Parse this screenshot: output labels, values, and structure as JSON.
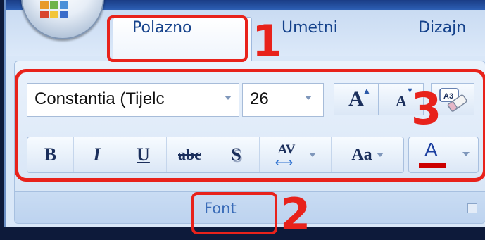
{
  "tabs": [
    {
      "label": "Polazno",
      "active": true
    },
    {
      "label": "Umetni",
      "active": false
    },
    {
      "label": "Dizajn",
      "active": false
    }
  ],
  "font_group": {
    "font_name": "Constantia (Tijelc",
    "font_size": "26",
    "group_label": "Font",
    "grow_label": "A",
    "shrink_label": "A",
    "clear_label": "A3",
    "bold": "B",
    "italic": "I",
    "underline": "U",
    "strikethrough": "abc",
    "shadow": "S",
    "spacing": "AV",
    "change_case": "Aa",
    "font_color": "A"
  },
  "callouts": {
    "one": "1",
    "two": "2",
    "three": "3"
  },
  "colors": {
    "callout": "#e8221b",
    "ribbon_text": "#15428b",
    "font_color_bar": "#cc0000"
  },
  "icons": [
    "office-orb-icon",
    "dropdown-arrow-icon",
    "grow-font-icon",
    "shrink-font-icon",
    "clear-formatting-icon",
    "dialog-launcher-icon"
  ]
}
